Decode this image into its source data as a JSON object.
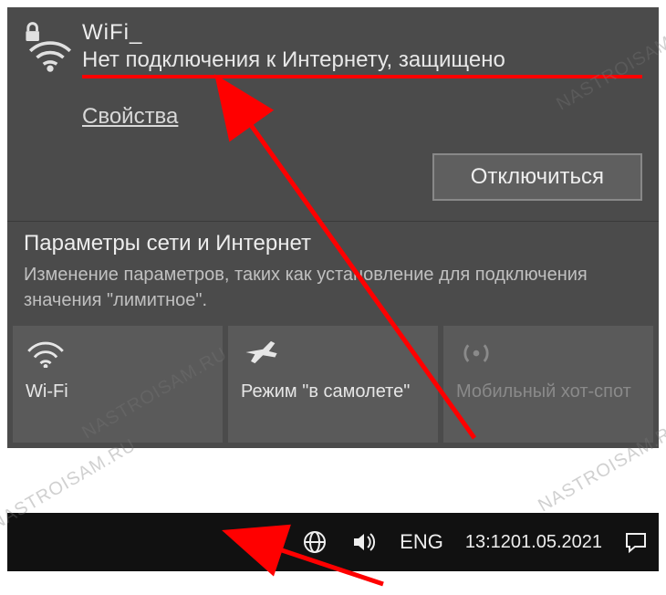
{
  "network": {
    "ssid": "WiFi_",
    "status": "Нет подключения к Интернету, защищено",
    "properties_label": "Свойства",
    "disconnect_label": "Отключиться"
  },
  "settings": {
    "title": "Параметры сети и Интернет",
    "description": "Изменение параметров, таких как установление для подключения значения \"лимитное\"."
  },
  "tiles": {
    "wifi": "Wi-Fi",
    "airplane": "Режим \"в самолете\"",
    "hotspot": "Мобильный хот-спот"
  },
  "tray": {
    "lang": "ENG",
    "time": "13:12",
    "date": "01.05.2021"
  },
  "watermark": "NASTROISAM.RU"
}
